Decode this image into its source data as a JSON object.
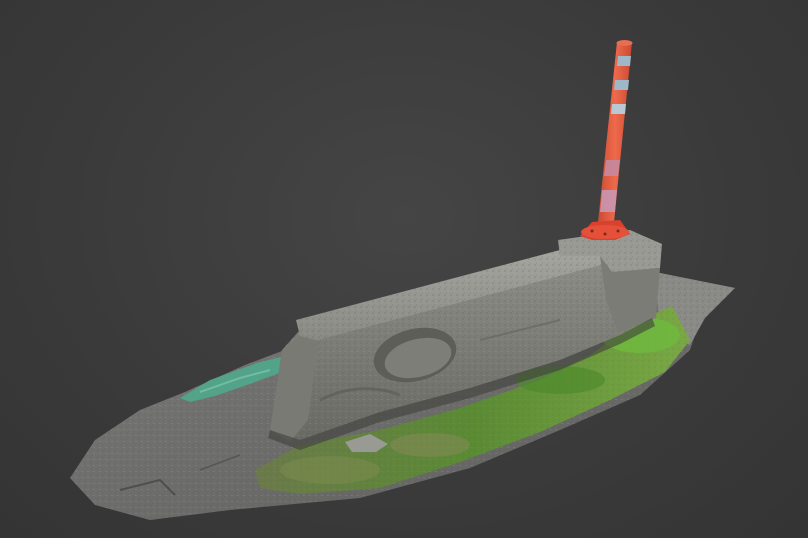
{
  "scene": {
    "background_color": "#3d3d3d",
    "subject": "photogrammetry-model",
    "colors": {
      "concrete": "#8a8a86",
      "asphalt": "#6f6f6f",
      "grass": "#5d8a34",
      "paint_green": "#4fa88c",
      "pole_orange": "#e2583c",
      "pole_stripe": "#9fb8c8",
      "pole_base": "#d9412e"
    }
  }
}
